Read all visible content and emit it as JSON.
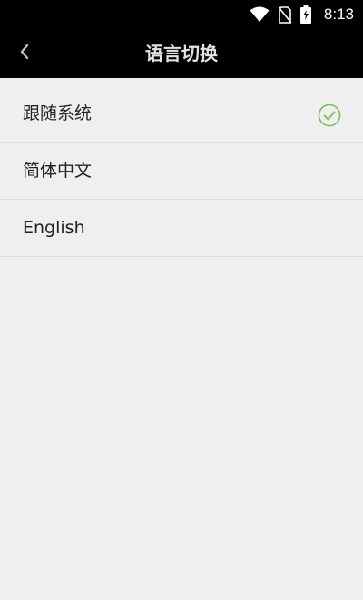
{
  "status_bar": {
    "time": "8:13",
    "icons": [
      "wifi-icon",
      "no-sim-icon",
      "battery-charging-icon"
    ]
  },
  "app_bar": {
    "title": "语言切换",
    "back_icon": "back-arrow-icon"
  },
  "languages": {
    "items": [
      {
        "label": "跟随系统",
        "selected": true
      },
      {
        "label": "简体中文",
        "selected": false
      },
      {
        "label": "English",
        "selected": false
      }
    ],
    "selected_color": "#7cbd5b"
  }
}
